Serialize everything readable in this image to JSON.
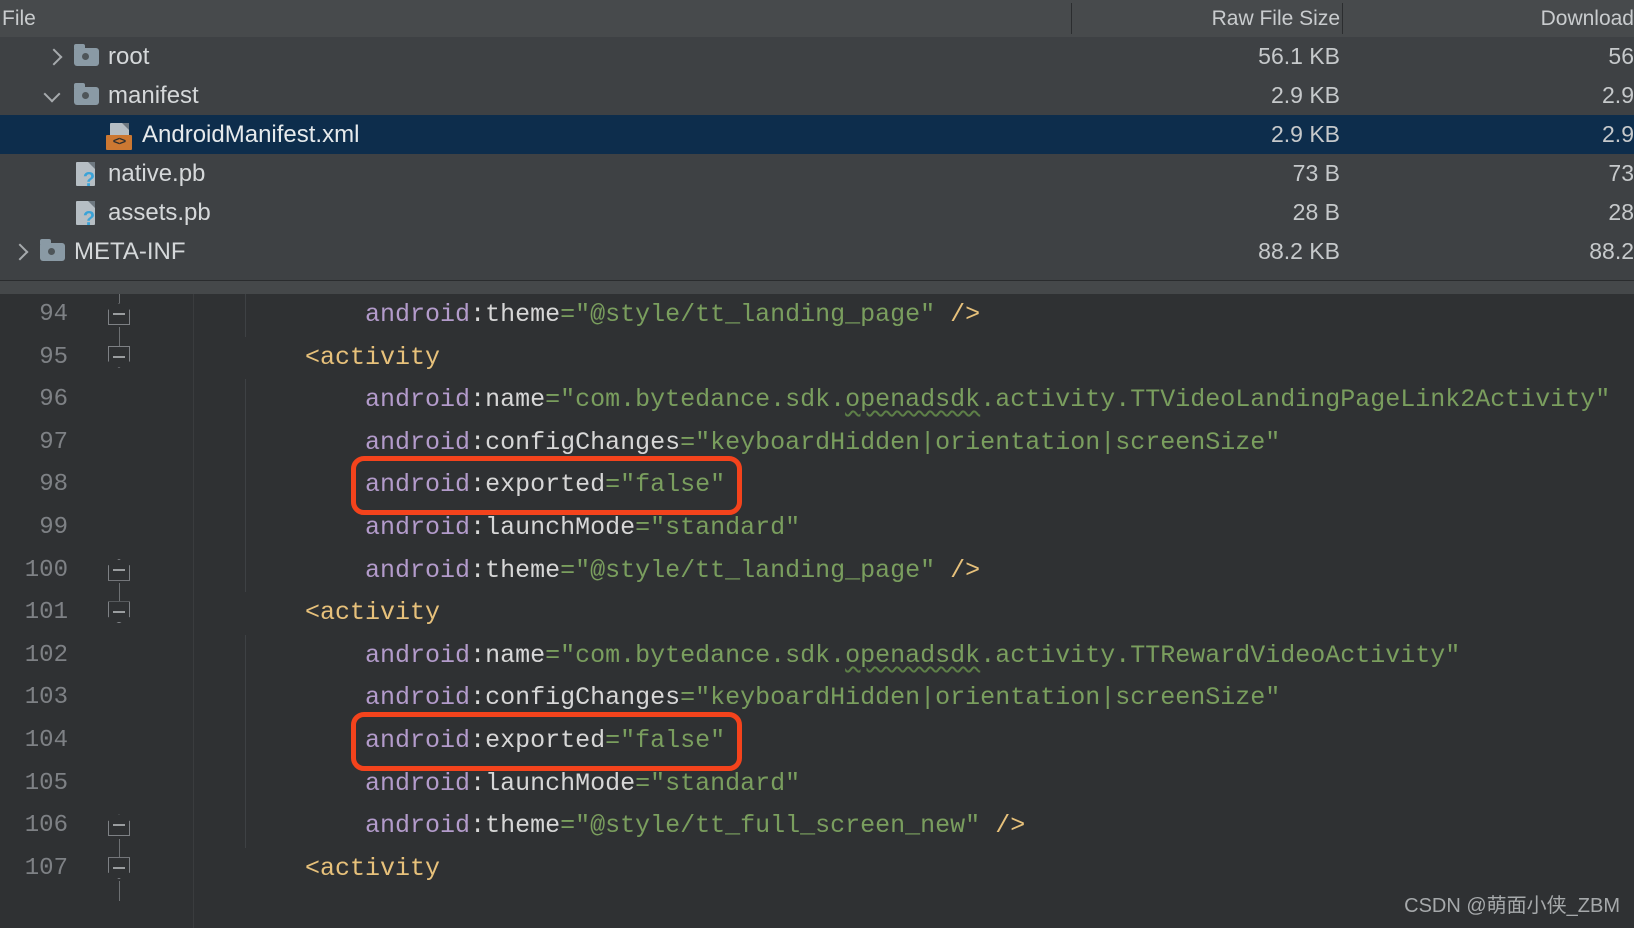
{
  "apk_analyzer": {
    "columns": {
      "file": "File",
      "raw_file_size": "Raw File Size",
      "download_size": "Download"
    },
    "rows": [
      {
        "name": "root",
        "icon": "folder-icon",
        "chevron": "chevron-right-icon",
        "depth": 1,
        "raw_size": "56.1 KB",
        "download_size": "56",
        "selected": false
      },
      {
        "name": "manifest",
        "icon": "folder-icon",
        "chevron": "chevron-down-icon",
        "depth": 1,
        "raw_size": "2.9 KB",
        "download_size": "2.9",
        "selected": false
      },
      {
        "name": "AndroidManifest.xml",
        "icon": "xml-file-icon",
        "chevron": "",
        "depth": 2,
        "raw_size": "2.9 KB",
        "download_size": "2.9",
        "selected": true
      },
      {
        "name": "native.pb",
        "icon": "unknown-file-icon",
        "chevron": "",
        "depth": 1,
        "raw_size": "73 B",
        "download_size": "73",
        "selected": false
      },
      {
        "name": "assets.pb",
        "icon": "unknown-file-icon",
        "chevron": "",
        "depth": 1,
        "raw_size": "28 B",
        "download_size": "28",
        "selected": false
      },
      {
        "name": "META-INF",
        "icon": "folder-icon",
        "chevron": "chevron-right-icon",
        "depth": 0,
        "raw_size": "88.2 KB",
        "download_size": "88.2",
        "selected": false
      }
    ]
  },
  "editor": {
    "language": "xml",
    "first_visible_line": 94,
    "last_visible_line": 107,
    "lines": [
      {
        "num": "94",
        "fold": "top",
        "indent_guide": true,
        "text": "        android:theme=\"@style/tt_landing_page\" />"
      },
      {
        "num": "95",
        "fold": "bot",
        "indent_guide": false,
        "text": "    <activity"
      },
      {
        "num": "96",
        "fold": "",
        "indent_guide": true,
        "text": "        android:name=\"com.bytedance.sdk.openadsdk.activity.TTVideoLandingPageLink2Activity\""
      },
      {
        "num": "97",
        "fold": "",
        "indent_guide": true,
        "text": "        android:configChanges=\"keyboardHidden|orientation|screenSize\""
      },
      {
        "num": "98",
        "fold": "",
        "indent_guide": true,
        "text": "        android:exported=\"false\""
      },
      {
        "num": "99",
        "fold": "",
        "indent_guide": true,
        "text": "        android:launchMode=\"standard\""
      },
      {
        "num": "100",
        "fold": "top",
        "indent_guide": true,
        "text": "        android:theme=\"@style/tt_landing_page\" />"
      },
      {
        "num": "101",
        "fold": "bot",
        "indent_guide": false,
        "text": "    <activity"
      },
      {
        "num": "102",
        "fold": "",
        "indent_guide": true,
        "text": "        android:name=\"com.bytedance.sdk.openadsdk.activity.TTRewardVideoActivity\""
      },
      {
        "num": "103",
        "fold": "",
        "indent_guide": true,
        "text": "        android:configChanges=\"keyboardHidden|orientation|screenSize\""
      },
      {
        "num": "104",
        "fold": "",
        "indent_guide": true,
        "text": "        android:exported=\"false\""
      },
      {
        "num": "105",
        "fold": "",
        "indent_guide": true,
        "text": "        android:launchMode=\"standard\""
      },
      {
        "num": "106",
        "fold": "top",
        "indent_guide": true,
        "text": "        android:theme=\"@style/tt_full_screen_new\" />"
      },
      {
        "num": "107",
        "fold": "bot",
        "indent_guide": false,
        "text": "    <activity"
      }
    ]
  },
  "annotations": [
    {
      "label": "android:exported=\"false\"",
      "target_line": "98",
      "color": "#F4431C"
    },
    {
      "label": "android:exported=\"false\"",
      "target_line": "104",
      "color": "#F4431C"
    }
  ],
  "watermark": {
    "text": "CSDN @萌面小侠_ZBM"
  },
  "colors": {
    "header_bg": "#474A4C",
    "tree_bg": "#3E4144",
    "selection_bg": "#0D2D4C",
    "editor_bg": "#2F3133",
    "annotation": "#F4431C",
    "attribute": "#B39BCB",
    "string": "#7A9E5E",
    "tag": "#E7C17B"
  }
}
